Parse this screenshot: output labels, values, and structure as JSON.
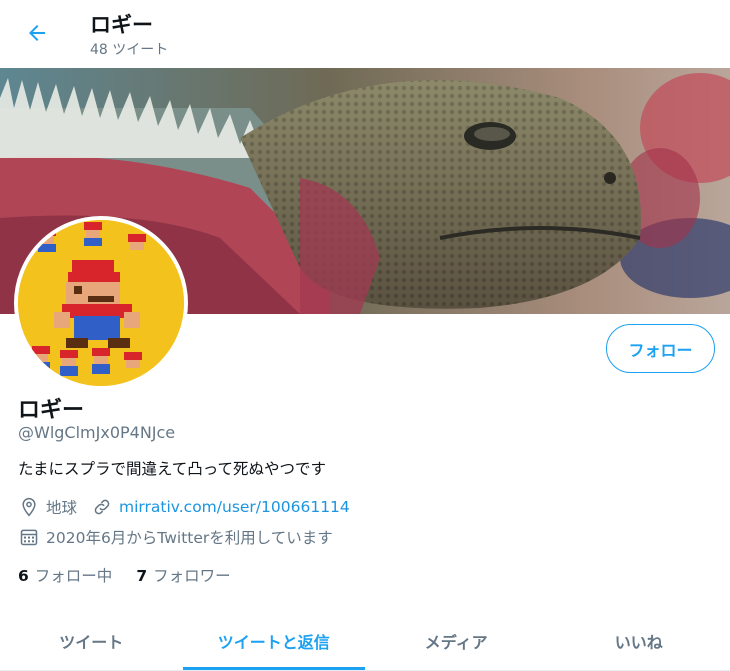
{
  "header": {
    "title": "ロギー",
    "tweet_count": "48 ツイート",
    "back_icon": "arrow-left-icon"
  },
  "profile": {
    "display_name": "ロギー",
    "handle": "@WlgClmJx0P4NJce",
    "bio": "たまにスプラで間違えて凸って死ぬやつです",
    "location": "地球",
    "url": "mirrativ.com/user/100661114",
    "joined": "2020年6月からTwitterを利用しています"
  },
  "actions": {
    "follow_label": "フォロー"
  },
  "stats": {
    "following_count": "6",
    "following_label": "フォロー中",
    "followers_count": "7",
    "followers_label": "フォロワー"
  },
  "tabs": [
    {
      "label": "ツイート",
      "active": false
    },
    {
      "label": "ツイートと返信",
      "active": true
    },
    {
      "label": "メディア",
      "active": false
    },
    {
      "label": "いいね",
      "active": false
    }
  ],
  "colors": {
    "accent": "#1da1f2",
    "link": "#1b95e0",
    "secondary_text": "#657786",
    "avatar_bg": "#f4c21c"
  }
}
